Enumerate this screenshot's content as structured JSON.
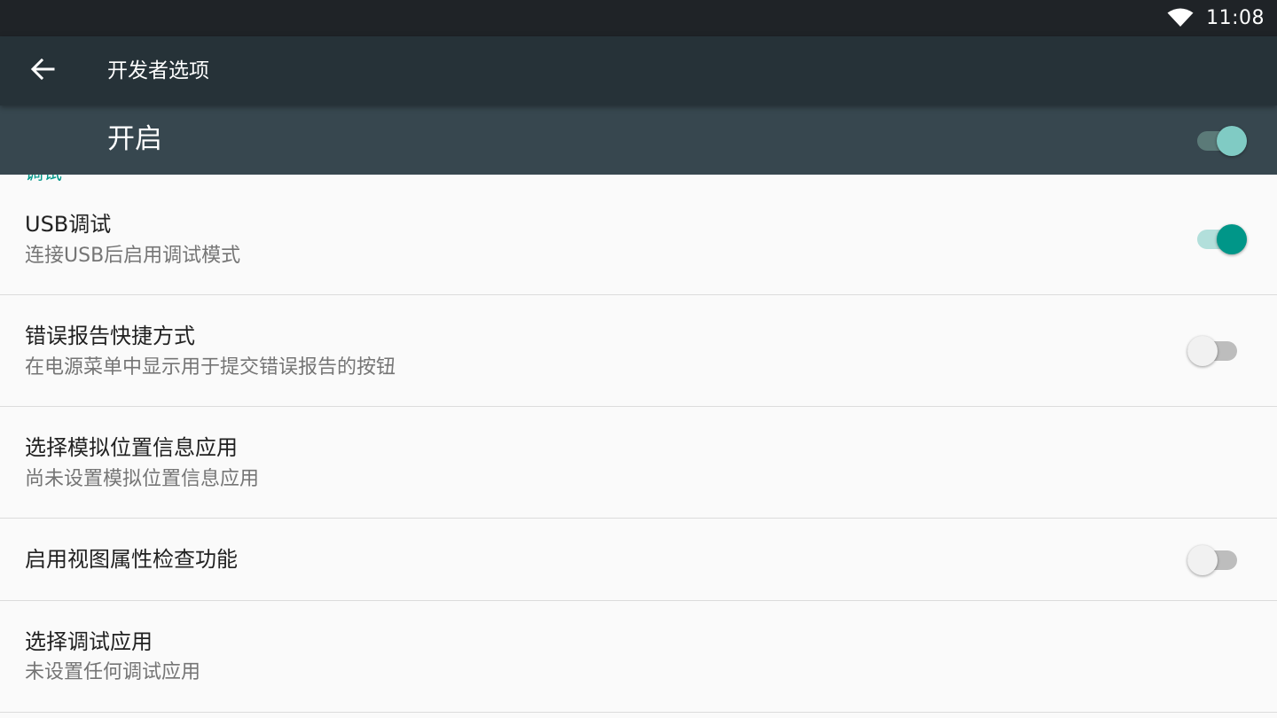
{
  "status_bar": {
    "time": "11:08",
    "icons": [
      "wifi-icon"
    ]
  },
  "app_bar": {
    "back_icon": "arrow-back-icon",
    "title": "开发者选项"
  },
  "master_switch": {
    "label": "开启",
    "checked": true
  },
  "category": {
    "label": "调试"
  },
  "settings": [
    {
      "title": "USB调试",
      "summary": "连接USB后启用调试模式",
      "has_switch": true,
      "checked": true
    },
    {
      "title": "错误报告快捷方式",
      "summary": "在电源菜单中显示用于提交错误报告的按钮",
      "has_switch": true,
      "checked": false
    },
    {
      "title": "选择模拟位置信息应用",
      "summary": "尚未设置模拟位置信息应用",
      "has_switch": false
    },
    {
      "title": "启用视图属性检查功能",
      "summary": "",
      "has_switch": true,
      "checked": false
    },
    {
      "title": "选择调试应用",
      "summary": "未设置任何调试应用",
      "has_switch": false
    }
  ],
  "colors": {
    "accent": "#009688",
    "app_bar": "#263238",
    "master_bar": "#37474f",
    "status_bar": "#1f2327"
  }
}
